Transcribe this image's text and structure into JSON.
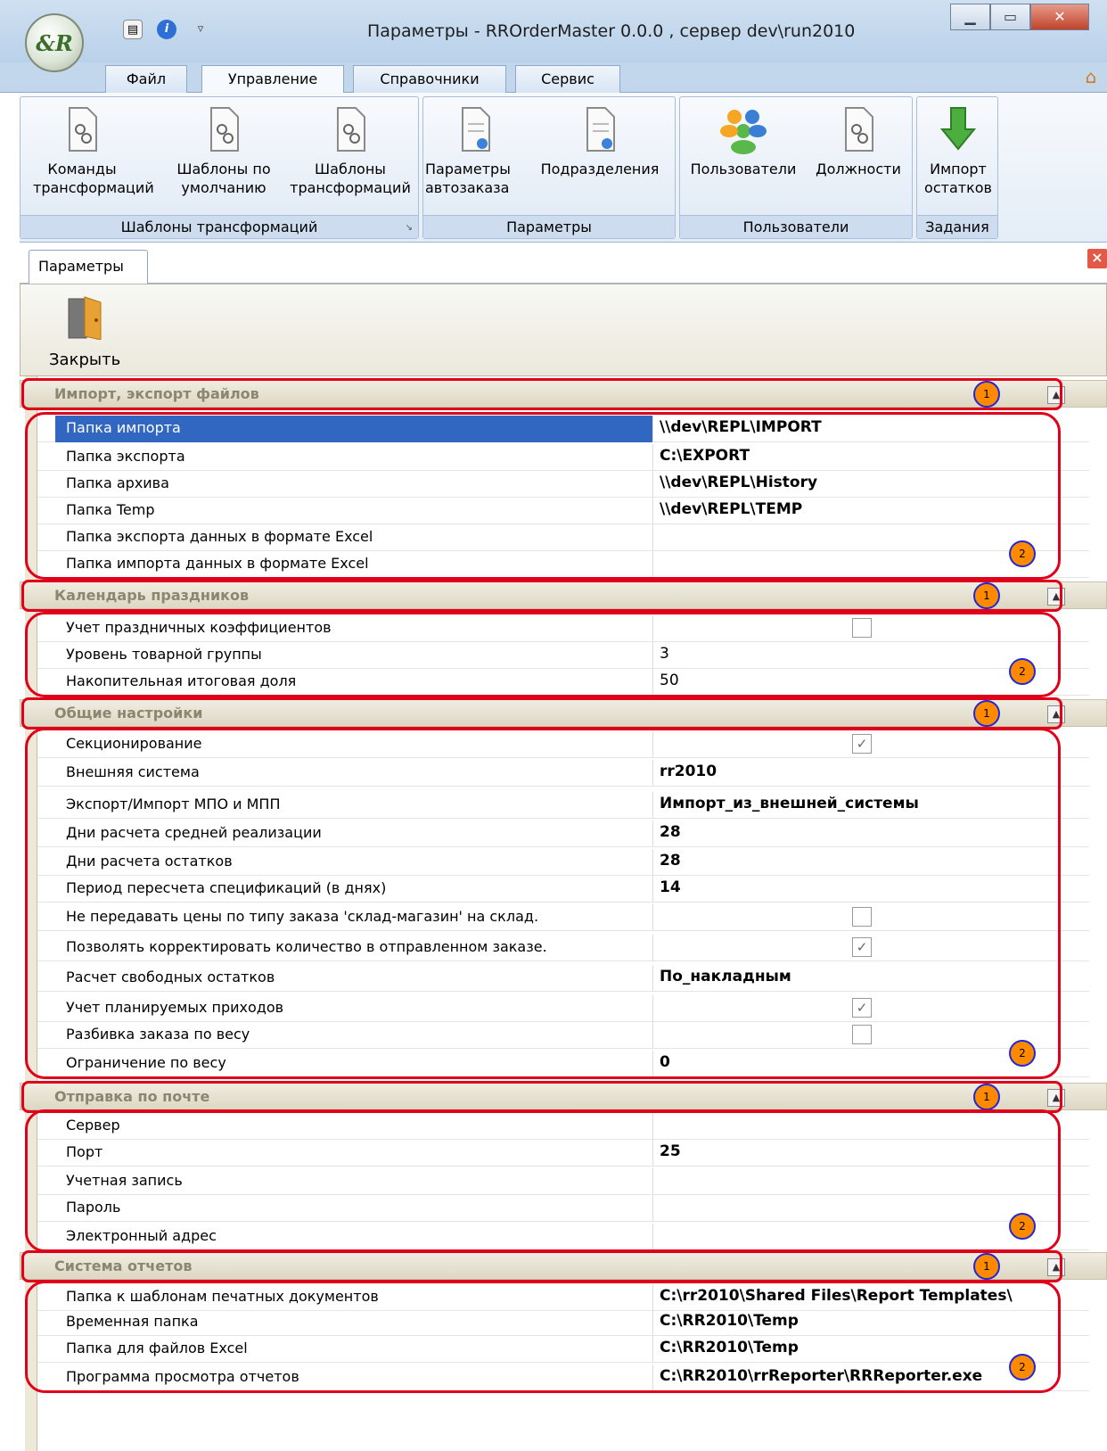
{
  "window": {
    "title": "Параметры - RROrderMaster 0.0.0 , сервер dev\\run2010",
    "orb_text": "&R"
  },
  "ribbon_tabs": [
    "Файл",
    "Управление",
    "Справочники",
    "Сервис"
  ],
  "ribbon": {
    "groups": [
      {
        "label": "Шаблоны трансформаций",
        "buttons": [
          "Команды\nтрансформаций",
          "Шаблоны по\nумолчанию",
          "Шаблоны\nтрансформаций"
        ]
      },
      {
        "label": "Параметры",
        "buttons": [
          "Параметры\nавтозаказа",
          "Подразделения"
        ]
      },
      {
        "label": "Пользователи",
        "buttons": [
          "Пользователи",
          "Должности"
        ]
      },
      {
        "label": "Задания",
        "buttons": [
          "Импорт\nостатков"
        ]
      }
    ]
  },
  "doc_tab": {
    "label": "Параметры"
  },
  "toolbar": {
    "close_label": "Закрыть"
  },
  "grid": {
    "categories": [
      {
        "title": "Импорт, экспорт файлов",
        "rows": [
          {
            "name": "Папка импорта",
            "value": "\\\\dev\\REPL\\IMPORT",
            "bold": true
          },
          {
            "name": "Папка экспорта",
            "value": "C:\\EXPORT",
            "bold": true
          },
          {
            "name": "Папка архива",
            "value": "\\\\dev\\REPL\\History",
            "bold": true
          },
          {
            "name": "Папка Temp",
            "value": "\\\\dev\\REPL\\TEMP",
            "bold": true
          },
          {
            "name": "Папка экспорта данных в формате Excel",
            "value": ""
          },
          {
            "name": "Папка импорта данных в формате Excel",
            "value": ""
          }
        ]
      },
      {
        "title": "Календарь праздников",
        "rows": [
          {
            "name": "Учет праздничных коэффициентов",
            "checkbox": false
          },
          {
            "name": "Уровень товарной группы",
            "value": "3"
          },
          {
            "name": "Накопительная итоговая доля",
            "value": "50"
          }
        ]
      },
      {
        "title": "Общие настройки",
        "rows": [
          {
            "name": "Секционирование",
            "checkbox": true
          },
          {
            "name": "Внешняя система",
            "value": "rr2010",
            "bold": true
          },
          {
            "name": "Экспорт/Импорт МПО и МПП",
            "value": "Импорт_из_внешней_системы",
            "bold": true
          },
          {
            "name": "Дни расчета средней реализации",
            "value": "28",
            "bold": true
          },
          {
            "name": "Дни расчета остатков",
            "value": "28",
            "bold": true
          },
          {
            "name": "Период пересчета спецификаций (в днях)",
            "value": "14",
            "bold": true
          },
          {
            "name": "Не передавать цены по типу заказа 'склад-магазин' на склад.",
            "checkbox": false
          },
          {
            "name": "Позволять корректировать количество в отправленном заказе.",
            "checkbox": true
          },
          {
            "name": "Расчет свободных остатков",
            "value": "По_накладным",
            "bold": true
          },
          {
            "name": "Учет планируемых приходов",
            "checkbox": true
          },
          {
            "name": "Разбивка заказа по весу",
            "checkbox": false
          },
          {
            "name": "Ограничение по весу",
            "value": "0",
            "bold": true
          }
        ]
      },
      {
        "title": "Отправка по почте",
        "rows": [
          {
            "name": "Сервер",
            "value": ""
          },
          {
            "name": "Порт",
            "value": "25",
            "bold": true
          },
          {
            "name": "Учетная запись",
            "value": ""
          },
          {
            "name": "Пароль",
            "value": ""
          },
          {
            "name": "Электронный адрес",
            "value": ""
          }
        ]
      },
      {
        "title": "Система отчетов",
        "rows": [
          {
            "name": "Папка к шаблонам печатных документов",
            "value": "C:\\rr2010\\Shared Files\\Report Templates\\",
            "bold": true
          },
          {
            "name": "Временная папка",
            "value": "C:\\RR2010\\Temp",
            "bold": true
          },
          {
            "name": "Папка для файлов Excel",
            "value": "C:\\RR2010\\Temp",
            "bold": true
          },
          {
            "name": "Программа просмотра отчетов",
            "value": "C:\\RR2010\\rrReporter\\RRReporter.exe",
            "bold": true
          }
        ]
      }
    ]
  },
  "annotations": {
    "badge1": "1",
    "badge2": "2"
  },
  "colors": {
    "selection": "#3166c1",
    "annotation_red": "#e1001a",
    "badge_orange": "#ff8a00"
  }
}
